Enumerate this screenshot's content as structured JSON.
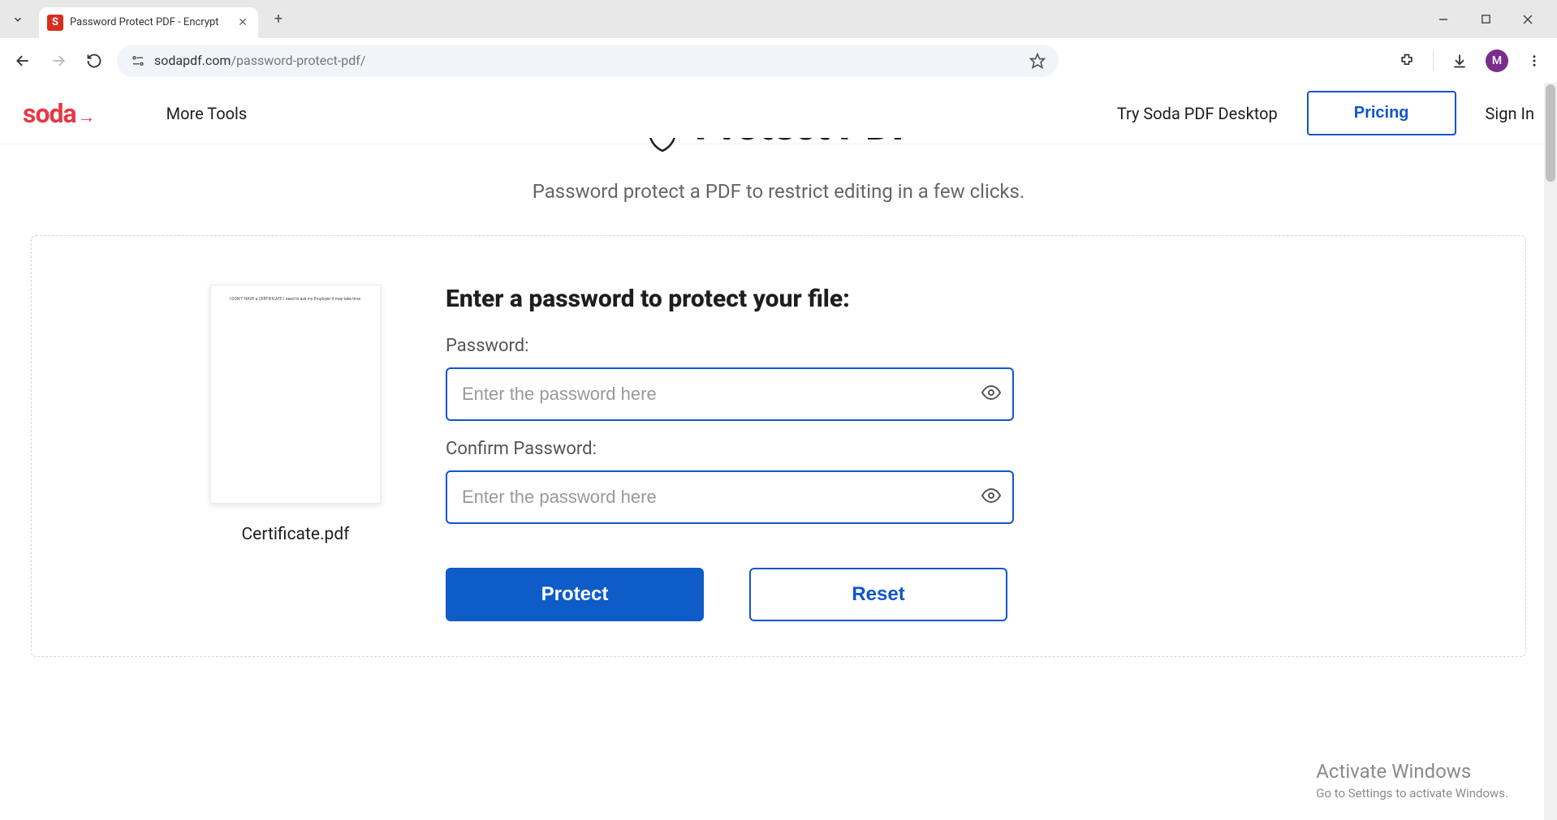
{
  "browser": {
    "tab_title": "Password Protect PDF - Encrypt",
    "tab_favicon_letter": "S",
    "url_domain": "sodapdf.com",
    "url_path": "/password-protect-pdf/",
    "avatar_letter": "M"
  },
  "nav": {
    "logo_text": "soda",
    "more_tools": "More Tools",
    "try_desktop": "Try Soda PDF Desktop",
    "pricing": "Pricing",
    "sign_in": "Sign In"
  },
  "hero": {
    "title": "Protect PDF",
    "subtitle": "Password protect a PDF to restrict editing in a few clicks."
  },
  "form": {
    "title": "Enter a password to protect your file:",
    "password_label": "Password:",
    "confirm_label": "Confirm Password:",
    "placeholder": "Enter the password here",
    "protect_btn": "Protect",
    "reset_btn": "Reset"
  },
  "preview": {
    "filename": "Certificate.pdf",
    "thumb_text": "I DON'T HAVE a CERTIFICATE I need to ask my Employer it may take time."
  },
  "watermark": {
    "line1": "Activate Windows",
    "line2": "Go to Settings to activate Windows."
  }
}
